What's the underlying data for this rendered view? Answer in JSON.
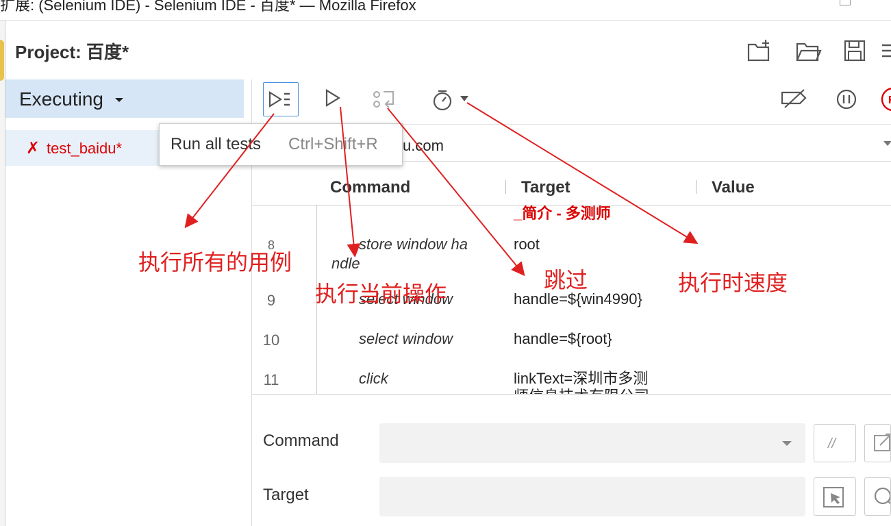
{
  "window": {
    "title": "扩展: (Selenium IDE) - Selenium IDE - 百度* — Mozilla Firefox"
  },
  "project": {
    "label": "Project:",
    "name": "百度*",
    "buttons": [
      "new-project-icon",
      "open-project-icon",
      "save-project-icon",
      "more-icon"
    ]
  },
  "sidebar": {
    "mode_label": "Executing",
    "tests": [
      {
        "status_icon": "✗",
        "name": "test_baidu*"
      }
    ]
  },
  "toolbar": {
    "tooltip": {
      "label": "Run all tests",
      "shortcut": "Ctrl+Shift+R"
    },
    "buttons": [
      "run-all-tests-icon",
      "run-current-test-icon",
      "step-over-icon",
      "speed-timer-icon",
      "disable-breakpoints-icon",
      "pause-icon",
      "record-icon"
    ]
  },
  "url_bar": {
    "value": "u.com"
  },
  "table": {
    "headers": [
      "Command",
      "Target",
      "Value"
    ],
    "partial_top_target": "_简介 - 多测师",
    "rows": [
      {
        "num": "8",
        "command_line1": "store window ha",
        "command_line2": "ndle",
        "target": "root",
        "value": ""
      },
      {
        "num": "9",
        "command": "select window",
        "target": "handle=${win4990}",
        "value": ""
      },
      {
        "num": "10",
        "command": "select window",
        "target": "handle=${root}",
        "value": ""
      },
      {
        "num": "11",
        "command": "click",
        "target_line1": "linkText=深圳市多测",
        "target_line2": "师信息技术有限公司",
        "value": ""
      }
    ]
  },
  "editor": {
    "command_label": "Command",
    "target_label": "Target",
    "command_value": "",
    "target_value": ""
  },
  "annotations": [
    {
      "text": "执行所有的用例"
    },
    {
      "text": "执行当前操作"
    },
    {
      "text": "跳过"
    },
    {
      "text": "执行时速度"
    }
  ],
  "colors": {
    "annotation_red": "#e02020",
    "failed_red": "#dd0000",
    "selected_bg": "#d6e6f6",
    "accent_blue": "#4a90d9"
  }
}
